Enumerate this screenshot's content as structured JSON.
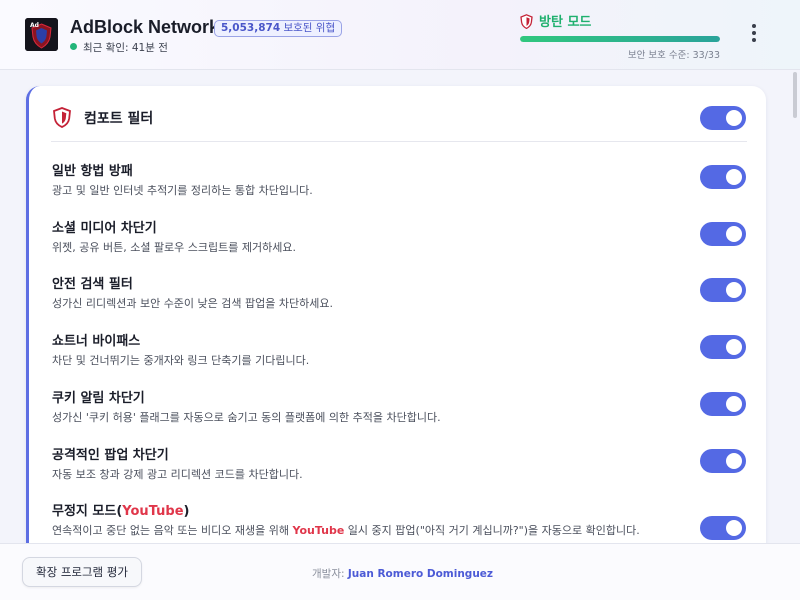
{
  "header": {
    "title": "AdBlock Network",
    "blocked_count": "5,053,874",
    "blocked_label": "보호된 위협",
    "last_check": "최근 확인: 41분 전",
    "mode_label": "방탄 모드",
    "protection_level_text": "보안 보호 수준: 33/33",
    "protection_level": 1.0
  },
  "card": {
    "title": "컴포트 필터",
    "master_enabled": true
  },
  "filters": [
    {
      "name": "일반 항법 방패",
      "desc": "광고 및 일반 인터넷 추적기를 정리하는 통합 차단입니다.",
      "enabled": true
    },
    {
      "name": "소셜 미디어 차단기",
      "desc": "위젯, 공유 버튼, 소셜 팔로우 스크립트를 제거하세요.",
      "enabled": true
    },
    {
      "name": "안전 검색 필터",
      "desc": "성가신 리디렉션과 보안 수준이 낮은 검색 팝업을 차단하세요.",
      "enabled": true
    },
    {
      "name": "쇼트너 바이패스",
      "desc": "차단 및 건너뛰기는 중개자와 링크 단축기를 기다립니다.",
      "enabled": true
    },
    {
      "name": "쿠키 알림 차단기",
      "desc": "성가신 '쿠키 허용' 플래그를 자동으로 숨기고 동의 플랫폼에 의한 추적을 차단합니다.",
      "enabled": true
    },
    {
      "name": "공격적인 팝업 차단기",
      "desc": "자동 보조 창과 강제 광고 리디렉션 코드를 차단합니다.",
      "enabled": true
    }
  ],
  "incognito": {
    "name_prefix": "무정지 모드(",
    "name_brand": "YouTube",
    "name_suffix": ")",
    "desc_prefix": "연속적이고 중단 없는 음악 또는 비디오 재생을 위해 ",
    "desc_brand": "YouTube",
    "desc_suffix": " 일시 중지 팝업(\"아직 거기 계십니까?\")을 자동으로 확인합니다.",
    "enabled": true
  },
  "footer": {
    "rate_label": "확장 프로그램 평가",
    "dev_prefix": "개발자: ",
    "dev_name": "Juan Romero Dominguez"
  },
  "colors": {
    "accent": "#5469e4",
    "mode_green": "#1fb06e",
    "youtube_red": "#e0364a",
    "logo_bg": "#14141c"
  }
}
